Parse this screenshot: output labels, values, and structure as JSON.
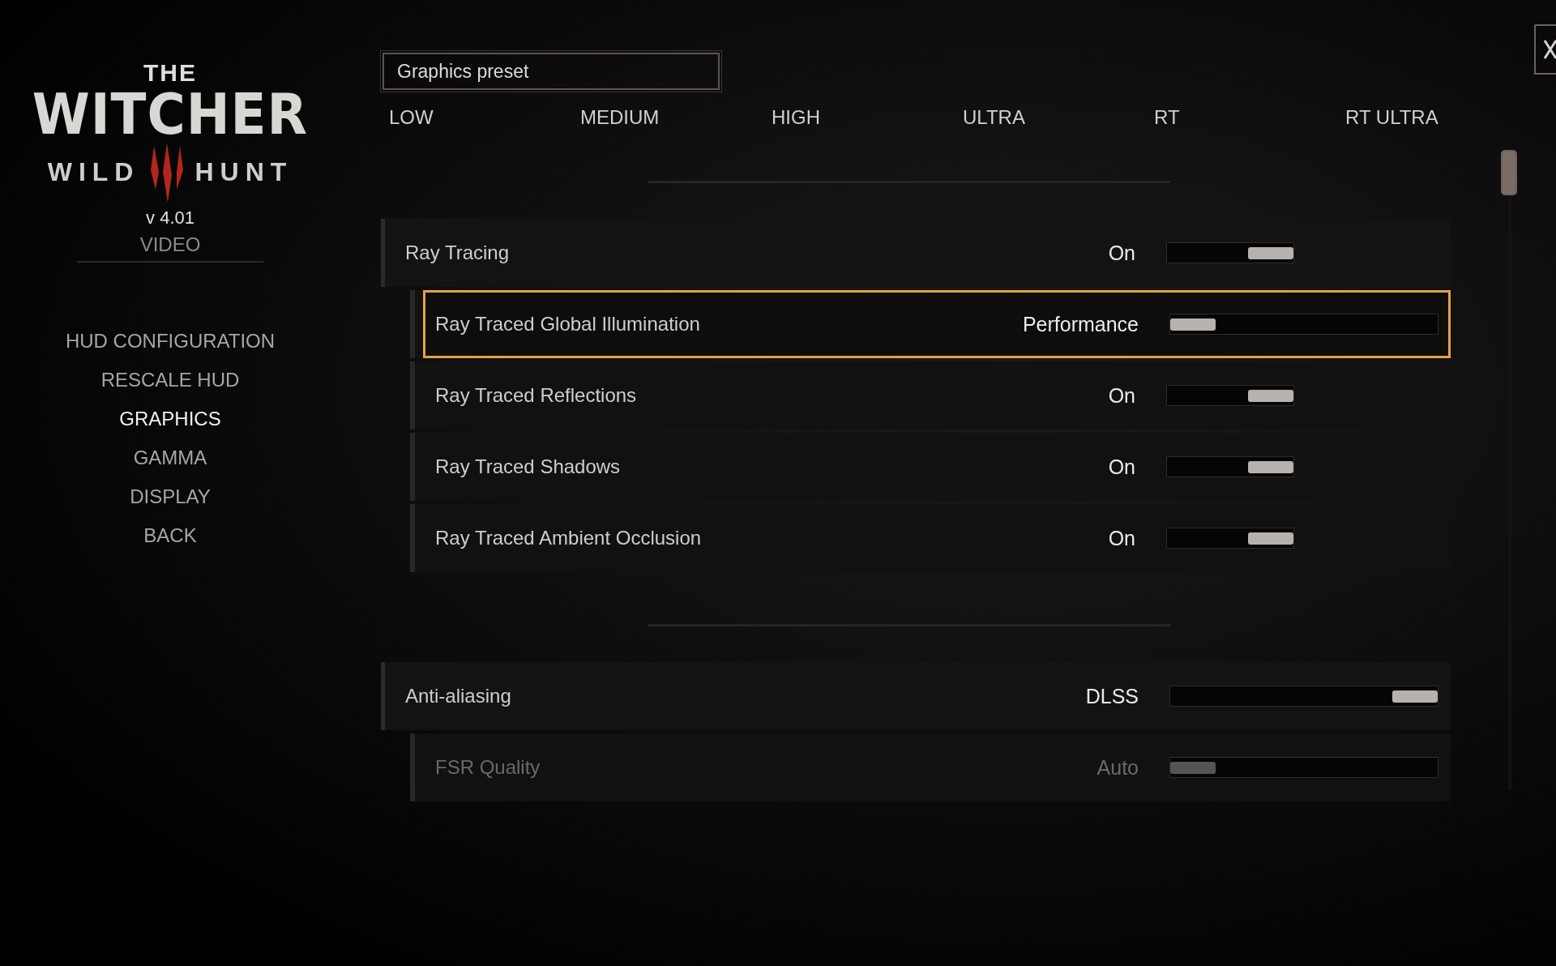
{
  "logo": {
    "top": "THE",
    "main": "WITCHER",
    "left": "WILD",
    "right": "HUNT"
  },
  "version": "v 4.01",
  "section": "VIDEO",
  "menu": [
    {
      "label": "HUD CONFIGURATION",
      "selected": false
    },
    {
      "label": "RESCALE HUD",
      "selected": false
    },
    {
      "label": "GRAPHICS",
      "selected": true
    },
    {
      "label": "GAMMA",
      "selected": false
    },
    {
      "label": "DISPLAY",
      "selected": false
    },
    {
      "label": "BACK",
      "selected": false
    }
  ],
  "preset": {
    "title": "Graphics preset",
    "options": [
      "LOW",
      "MEDIUM",
      "HIGH",
      "ULTRA",
      "RT",
      "RT ULTRA"
    ]
  },
  "groups": [
    {
      "settings": [
        {
          "kind": "toggle",
          "label": "Ray Tracing",
          "value": "On",
          "level": 1,
          "sub": false,
          "selected": false,
          "disabled": false
        },
        {
          "kind": "slider",
          "label": "Ray Traced Global Illumination",
          "value": "Performance",
          "level": 0,
          "sub": true,
          "selected": true,
          "disabled": false
        },
        {
          "kind": "toggle",
          "label": "Ray Traced Reflections",
          "value": "On",
          "level": 1,
          "sub": true,
          "selected": false,
          "disabled": false
        },
        {
          "kind": "toggle",
          "label": "Ray Traced Shadows",
          "value": "On",
          "level": 1,
          "sub": true,
          "selected": false,
          "disabled": false
        },
        {
          "kind": "toggle",
          "label": "Ray Traced Ambient Occlusion",
          "value": "On",
          "level": 1,
          "sub": true,
          "selected": false,
          "disabled": false
        }
      ]
    },
    {
      "settings": [
        {
          "kind": "slider",
          "label": "Anti-aliasing",
          "value": "DLSS",
          "level": 1,
          "sub": false,
          "selected": false,
          "disabled": false
        },
        {
          "kind": "slider",
          "label": "FSR Quality",
          "value": "Auto",
          "level": 0,
          "sub": true,
          "selected": false,
          "disabled": true
        }
      ]
    }
  ]
}
